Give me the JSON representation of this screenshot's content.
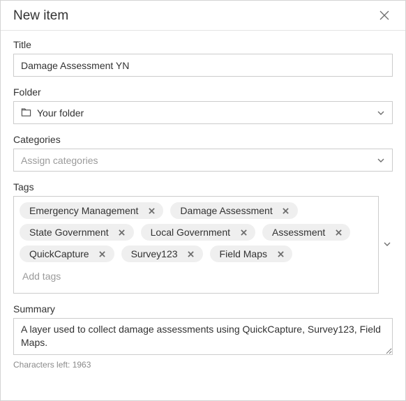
{
  "header": {
    "title": "New item"
  },
  "title_field": {
    "label": "Title",
    "value": "Damage Assessment YN"
  },
  "folder_field": {
    "label": "Folder",
    "value": "Your folder"
  },
  "categories_field": {
    "label": "Categories",
    "placeholder": "Assign categories"
  },
  "tags_field": {
    "label": "Tags",
    "items": [
      "Emergency Management",
      "Damage Assessment",
      "State Government",
      "Local Government",
      "Assessment",
      "QuickCapture",
      "Survey123",
      "Field Maps"
    ],
    "placeholder": "Add tags"
  },
  "summary_field": {
    "label": "Summary",
    "value": "A layer used to collect damage assessments using QuickCapture, Survey123, Field Maps.",
    "chars_left": "Characters left: 1963"
  }
}
